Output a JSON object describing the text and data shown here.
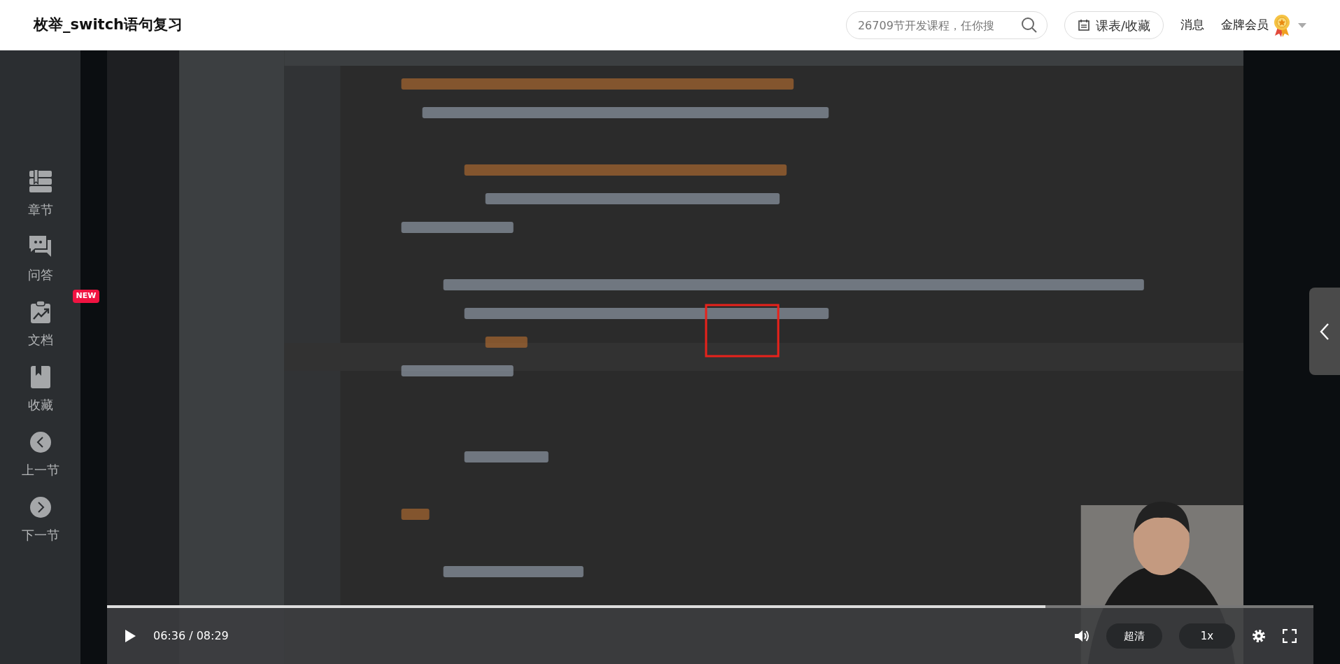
{
  "header": {
    "title": "枚举_switch语句复习",
    "search": {
      "placeholder": "26709节开发课程，任你搜"
    },
    "schedule_button": "课表/收藏",
    "messages": "消息",
    "member": "金牌会员"
  },
  "sidebar": {
    "items": [
      {
        "kind": "chapters",
        "label": "章节"
      },
      {
        "kind": "qa",
        "label": "问答"
      },
      {
        "kind": "docs",
        "label": "文档",
        "badge": "NEW"
      },
      {
        "kind": "favorites",
        "label": "收藏"
      },
      {
        "kind": "prev",
        "label": "上一节"
      },
      {
        "kind": "next",
        "label": "下一节"
      }
    ]
  },
  "player": {
    "time": "06:36 / 08:29",
    "level": 0.778,
    "quality": "超清",
    "speed": "1x",
    "playing": false
  }
}
